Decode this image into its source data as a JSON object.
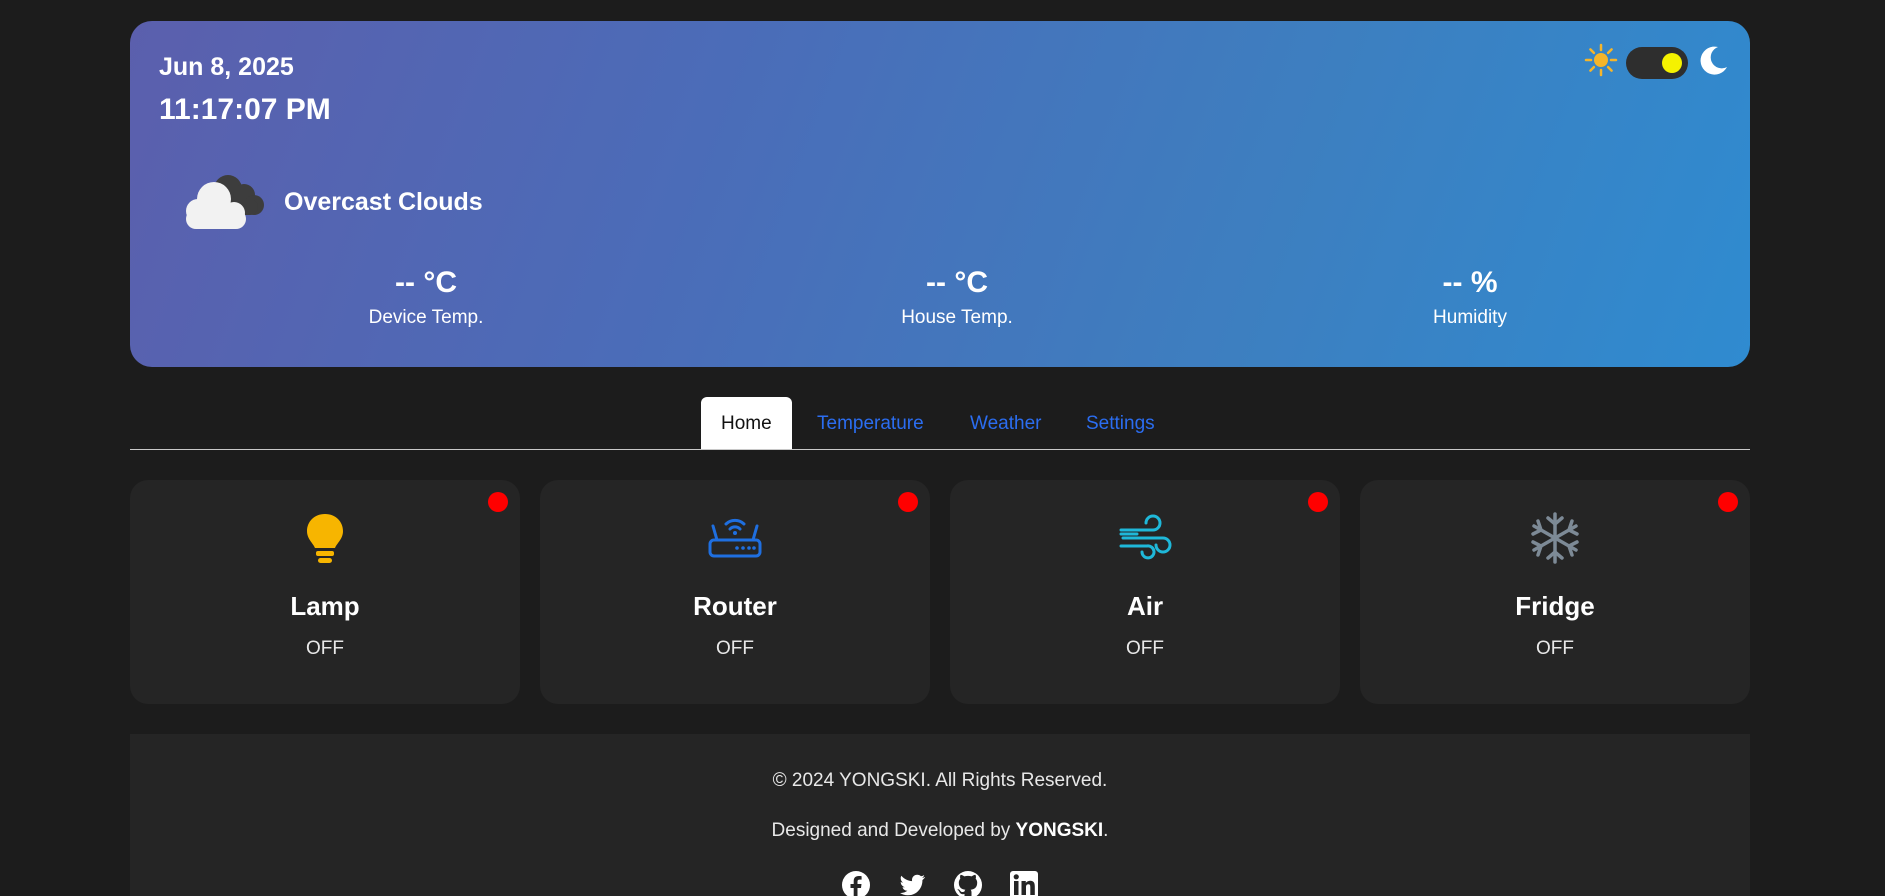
{
  "hero": {
    "date": "Jun 8, 2025",
    "time": "11:17:07 PM",
    "condition": "Overcast Clouds",
    "stats": [
      {
        "value": "-- °C",
        "label": "Device Temp."
      },
      {
        "value": "-- °C",
        "label": "House Temp."
      },
      {
        "value": "-- %",
        "label": "Humidity"
      }
    ],
    "theme_toggle": {
      "light_icon": "sun-icon",
      "dark_icon": "moon-icon",
      "state": "dark"
    }
  },
  "tabs": [
    {
      "label": "Home",
      "active": true
    },
    {
      "label": "Temperature",
      "active": false
    },
    {
      "label": "Weather",
      "active": false
    },
    {
      "label": "Settings",
      "active": false
    }
  ],
  "devices": [
    {
      "name": "Lamp",
      "state": "OFF",
      "icon": "lightbulb-icon",
      "icon_color": "#f7b500",
      "status_color": "#ff0000"
    },
    {
      "name": "Router",
      "state": "OFF",
      "icon": "router-icon",
      "icon_color": "#1f6fe0",
      "status_color": "#ff0000"
    },
    {
      "name": "Air",
      "state": "OFF",
      "icon": "wind-icon",
      "icon_color": "#1fb8d9",
      "status_color": "#ff0000"
    },
    {
      "name": "Fridge",
      "state": "OFF",
      "icon": "snowflake-icon",
      "icon_color": "#7d8a96",
      "status_color": "#ff0000"
    }
  ],
  "footer": {
    "copyright": "©  2024 YONGSKI. All Rights Reserved.",
    "designed_prefix": "Designed and Developed by ",
    "designed_name": "YONGSKI",
    "designed_suffix": ".",
    "socials": [
      "facebook-icon",
      "twitter-icon",
      "github-icon",
      "linkedin-icon"
    ]
  },
  "colors": {
    "background": "#1c1c1c",
    "card": "#252525",
    "accent_link": "#2b6df0",
    "toggle_knob": "#f5f200"
  }
}
